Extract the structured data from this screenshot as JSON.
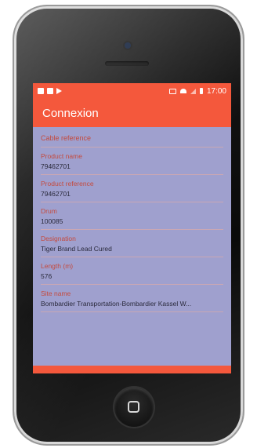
{
  "statusbar": {
    "time": "17:00"
  },
  "appbar": {
    "title": "Connexion"
  },
  "section": {
    "title": "Cable reference"
  },
  "fields": [
    {
      "label": "Product name",
      "value": "79462701"
    },
    {
      "label": "Product reference",
      "value": "79462701"
    },
    {
      "label": "Drum",
      "value": "100085"
    },
    {
      "label": "Designation",
      "value": "Tiger Brand Lead Cured"
    },
    {
      "label": "Length (m)",
      "value": "576"
    },
    {
      "label": "Site name",
      "value": "Bombardier Transportation-Bombardier Kassel W..."
    }
  ],
  "colors": {
    "accent": "#f4583c",
    "screen_bg": "#9fa0ce",
    "label": "#c44a3e"
  }
}
